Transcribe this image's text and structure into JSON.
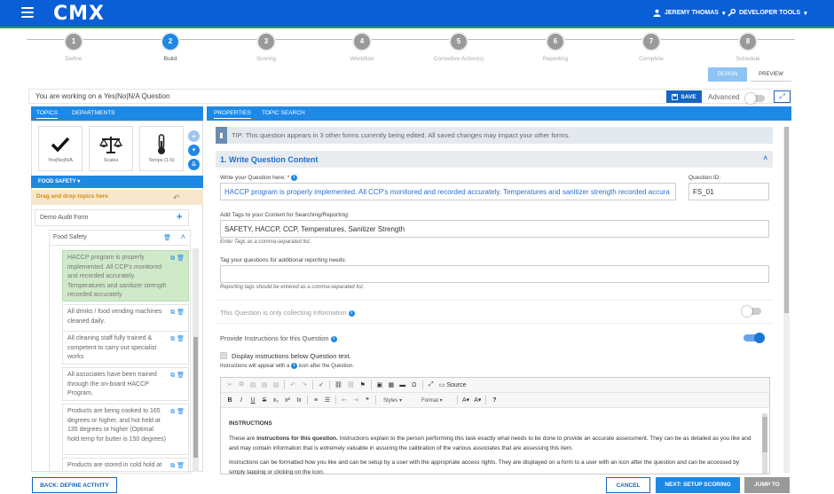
{
  "header": {
    "logo": "CMX",
    "user": "JEREMY THOMAS",
    "tools": "DEVELOPER TOOLS"
  },
  "steps": [
    {
      "num": "1",
      "label": "Define"
    },
    {
      "num": "2",
      "label": "Build"
    },
    {
      "num": "3",
      "label": "Scoring"
    },
    {
      "num": "4",
      "label": "Workflow"
    },
    {
      "num": "5",
      "label": "Corrective Action(s)"
    },
    {
      "num": "6",
      "label": "Reporting"
    },
    {
      "num": "7",
      "label": "Complete"
    },
    {
      "num": "8",
      "label": "Schedule"
    }
  ],
  "active_step": 2,
  "view_modes": {
    "design": "DESIGN",
    "preview": "PREVIEW"
  },
  "context": {
    "text": "You are working on a Yes|No|N/A Question",
    "save": "SAVE",
    "advanced": "Advanced"
  },
  "left": {
    "tabs": [
      "TOPICS",
      "DEPARTMENTS"
    ],
    "topic_cards": [
      {
        "icon": "checkmark-icon",
        "label": "Yes|No|N/A"
      },
      {
        "icon": "scales-icon",
        "label": "Scales"
      },
      {
        "icon": "thermometer-icon",
        "label": "Temps (1-6)"
      }
    ],
    "category_dropdown": "FOOD SAFETY",
    "drag_drop": "Drag and drop topics here",
    "form_name": "Demo Audit Form",
    "category": "Food Safety",
    "questions": [
      "HACCP program is properly implemented. All CCP's monitored and recorded accurately. Temperatures and sanitizer strength recorded accurately",
      "All drinks / food vending machines cleaned daily.",
      "All cleaning staff fully trained & competent to carry out specialist works",
      "All associates have been trained through the on-board HACCP Program.",
      "Products are being cooked to 165 degrees or higher, and hot held at 135 degrees or higher (Optimal hold temp for butter is 150 degrees)",
      "Products are stored in cold hold at"
    ]
  },
  "right": {
    "tabs": [
      "PROPERTIES",
      "TOPIC SEARCH"
    ],
    "tip": "TIP: This question appears in 3 other forms currently being edited. All saved changes may impact your other forms.",
    "section_title": "1. Write Question Content",
    "question_label": "Write your Question here: *",
    "question_value": "HACCP program is properly implemented. All CCP's monitored and recorded accurately. Temperatures and sanitizer strength recorded accura",
    "question_id_label": "Question ID:",
    "question_id": "FS_01",
    "tags_label": "Add Tags to your Content for Searching/Reporting:",
    "tags_value": "SAFETY, HACCP, CCP, Temperatures, Sanitizer Strength",
    "tags_hint": "Enter Tags as a comma-separated list.",
    "reporting_label": "Tag your questions for additional reporting needs:",
    "reporting_value": "",
    "reporting_hint": "Reporting tags should be entered as a comma-separated list.",
    "info_only_label": "This Question is only collecting Information",
    "instructions_label": "Provide Instructions for this Question",
    "display_below_label": "Display instructions below Question text.",
    "instructions_note_a": "Instructions will appear with a",
    "instructions_note_b": "icon after the Question.",
    "editor": {
      "source": "Source",
      "styles": "Styles",
      "format": "Format",
      "heading": "INSTRUCTIONS",
      "p1_a": "These are",
      "p1_b": "instructions for this question.",
      "p1_c": "Instructions explain to the person performing this task exactly what needs to be done to provide an accurate assessment. They can be as detailed as you like and and may contain information that is extremely valuable in assuring the calibration of the various associates that are assessing this item.",
      "p2": "Instructions can be formatted how you like and can be setup by a user with the appropriate access rights. They are displayed on a form to a user with an icon after the question and can be accessed by simply tapping or clicking on the icon."
    }
  },
  "footer": {
    "back": "BACK: DEFINE ACTIVITY",
    "cancel": "CANCEL",
    "next": "NEXT: SETUP SCORING",
    "jump": "JUMP TO"
  },
  "colors": {
    "primary": "#1e88e5",
    "header": "#0b5fd6",
    "accent_green": "#2e9e3e",
    "selected_item": "#cfe9c9"
  }
}
